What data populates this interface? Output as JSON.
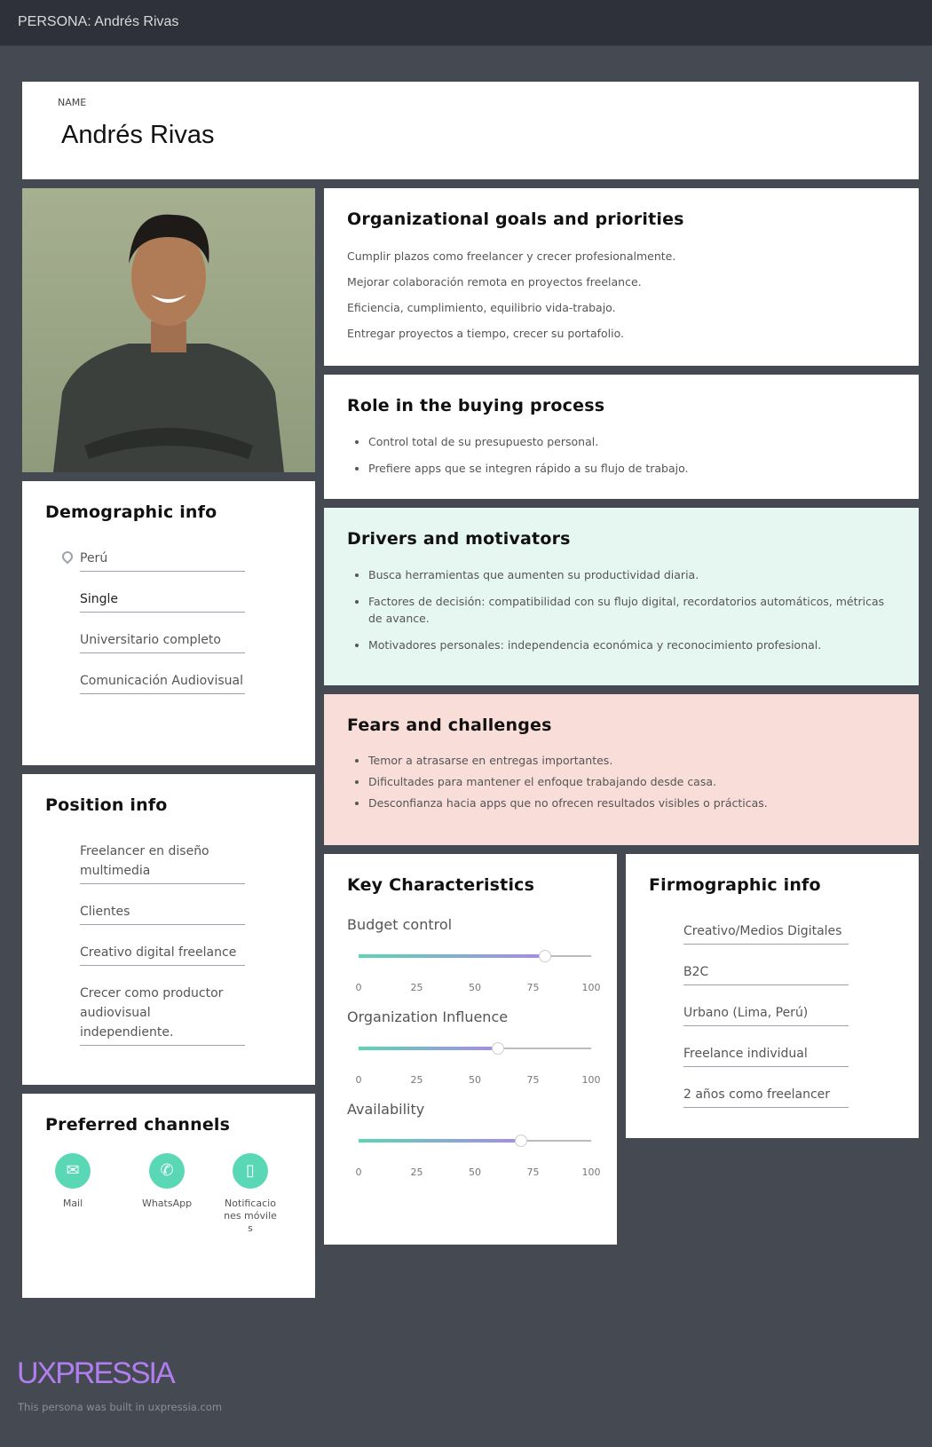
{
  "header": {
    "title": "PERSONA: Andrés Rivas"
  },
  "name_card": {
    "label": "NAME",
    "name": "Andrés Rivas"
  },
  "goals": {
    "title": "Organizational goals and priorities",
    "items": [
      "Cumplir plazos como freelancer y crecer profesionalmente.",
      "Mejorar colaboración remota en proyectos freelance.",
      "Eficiencia, cumplimiento, equilibrio vida-trabajo.",
      "Entregar proyectos a tiempo, crecer su portafolio."
    ]
  },
  "role": {
    "title": "Role in the buying process",
    "items": [
      "Control total de su presupuesto personal.",
      "Prefiere apps que se integren rápido a su flujo de trabajo."
    ]
  },
  "drivers": {
    "title": "Drivers and motivators",
    "color": "#e6f7f2",
    "items": [
      "Busca herramientas que aumenten su productividad diaria.",
      "Factores de decisión: compatibilidad con su flujo digital, recordatorios automáticos, métricas de avance.",
      "Motivadores personales: independencia económica y reconocimiento profesional."
    ]
  },
  "fears": {
    "title": "Fears and challenges",
    "color": "#f9ddd8",
    "items": [
      "Temor a atrasarse en entregas importantes.",
      "Dificultades para mantener el enfoque trabajando desde casa.",
      "Desconfianza hacia apps que no ofrecen resultados visibles o prácticas."
    ]
  },
  "demographic": {
    "title": "Demographic info",
    "fields": [
      "Perú",
      "Single",
      "Universitario completo",
      "Comunicación Audiovisual"
    ]
  },
  "position": {
    "title": "Position info",
    "fields": [
      "Freelancer en diseño multimedia",
      "Clientes",
      "Creativo digital freelance",
      "Crecer como productor audiovisual independiente."
    ]
  },
  "channels": {
    "title": "Preferred channels",
    "items": [
      {
        "label": "Mail",
        "icon": "mail-icon"
      },
      {
        "label": "WhatsApp",
        "icon": "whatsapp-icon"
      },
      {
        "label": "Notificaciones móviles",
        "icon": "mobile-phone-icon"
      }
    ]
  },
  "key": {
    "title": "Key Characteristics",
    "ticks": [
      "0",
      "25",
      "50",
      "75",
      "100"
    ],
    "sliders": [
      {
        "label": "Budget control",
        "value": 80
      },
      {
        "label": "Organization Influence",
        "value": 60
      },
      {
        "label": "Availability",
        "value": 70
      }
    ]
  },
  "firmographic": {
    "title": "Firmographic info",
    "fields": [
      "Creativo/Medios Digitales",
      "B2C",
      "Urbano (Lima, Perú)",
      "Freelance individual",
      "2 años como freelancer"
    ]
  },
  "footer": {
    "logo": "UXPRESSIA",
    "text": "This persona was built in uxpressia.com"
  }
}
